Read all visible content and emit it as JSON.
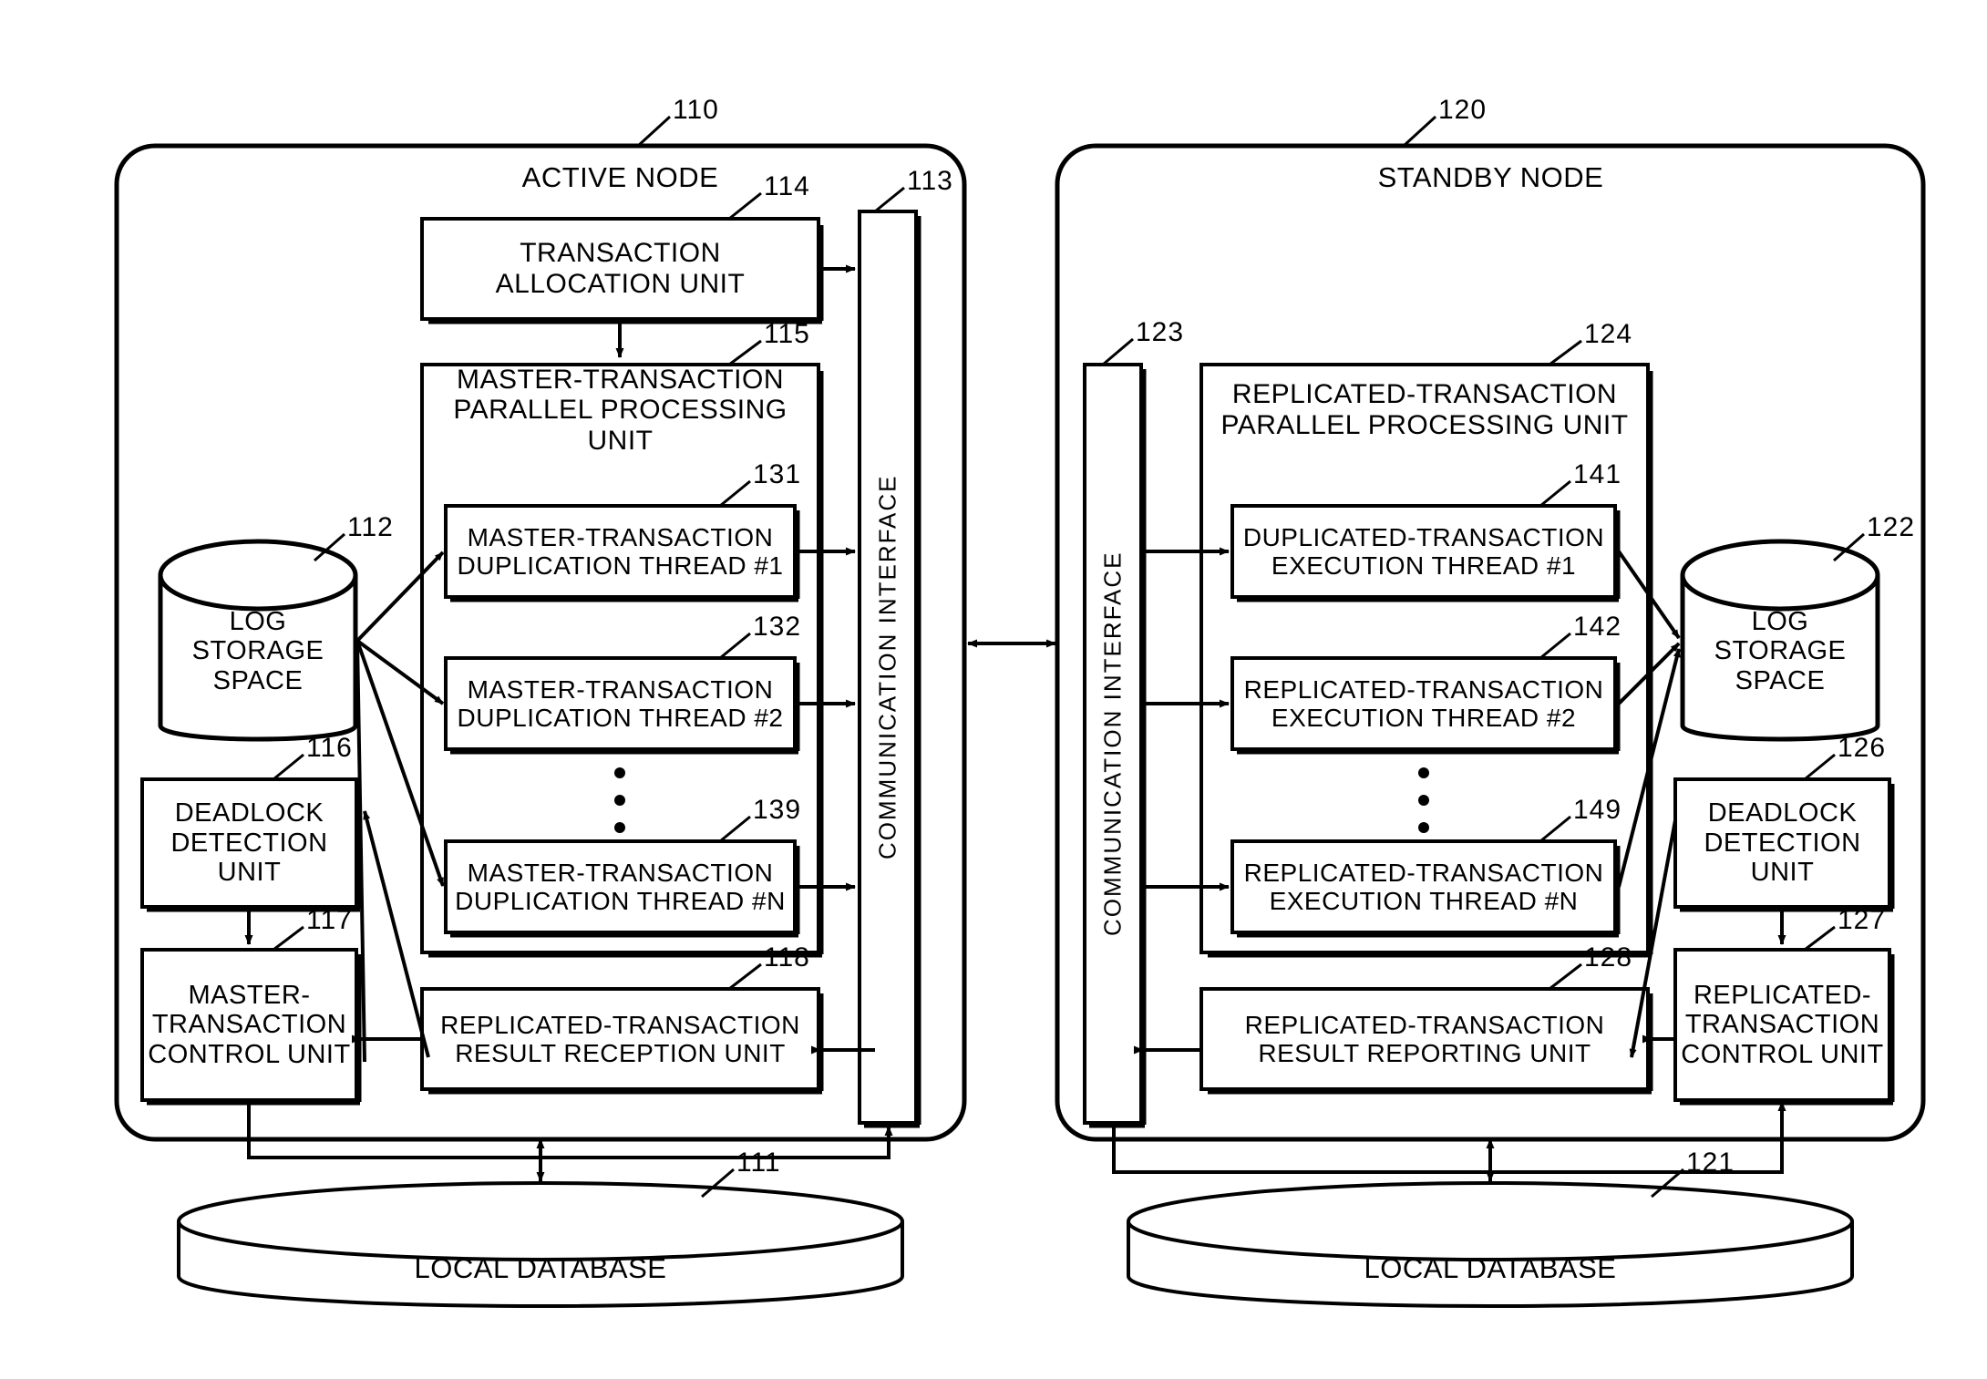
{
  "figure": {
    "type": "patent-block-diagram",
    "nodes": {
      "active": {
        "ref": "110",
        "title": "ACTIVE NODE",
        "local_database": {
          "ref": "111",
          "label": "LOCAL DATABASE"
        },
        "log_storage": {
          "ref": "112",
          "label": "LOG\nSTORAGE\nSPACE"
        },
        "communication_interface": {
          "ref": "113",
          "label": "COMMUNICATION INTERFACE"
        },
        "transaction_allocation_unit": {
          "ref": "114",
          "label": "TRANSACTION\nALLOCATION UNIT"
        },
        "parallel_processing_unit": {
          "ref": "115",
          "label": "MASTER-TRANSACTION\nPARALLEL PROCESSING UNIT"
        },
        "threads": [
          {
            "ref": "131",
            "label": "MASTER-TRANSACTION\nDUPLICATION THREAD #1"
          },
          {
            "ref": "132",
            "label": "MASTER-TRANSACTION\nDUPLICATION THREAD #2"
          },
          {
            "ref": "139",
            "label": "MASTER-TRANSACTION\nDUPLICATION THREAD #N"
          }
        ],
        "ellipsis": "•••",
        "deadlock_detection_unit": {
          "ref": "116",
          "label": "DEADLOCK\nDETECTION\nUNIT"
        },
        "control_unit": {
          "ref": "117",
          "label": "MASTER-\nTRANSACTION\nCONTROL UNIT"
        },
        "result_unit": {
          "ref": "118",
          "label": "REPLICATED-TRANSACTION\nRESULT RECEPTION UNIT"
        }
      },
      "standby": {
        "ref": "120",
        "title": "STANDBY NODE",
        "local_database": {
          "ref": "121",
          "label": "LOCAL DATABASE"
        },
        "log_storage": {
          "ref": "122",
          "label": "LOG\nSTORAGE\nSPACE"
        },
        "communication_interface": {
          "ref": "123",
          "label": "COMMUNICATION INTERFACE"
        },
        "parallel_processing_unit": {
          "ref": "124",
          "label": "REPLICATED-TRANSACTION\nPARALLEL PROCESSING UNIT"
        },
        "threads": [
          {
            "ref": "141",
            "label": "DUPLICATED-TRANSACTION\nEXECUTION THREAD #1"
          },
          {
            "ref": "142",
            "label": "REPLICATED-TRANSACTION\nEXECUTION THREAD #2"
          },
          {
            "ref": "149",
            "label": "REPLICATED-TRANSACTION\nEXECUTION THREAD #N"
          }
        ],
        "ellipsis": "•••",
        "deadlock_detection_unit": {
          "ref": "126",
          "label": "DEADLOCK\nDETECTION\nUNIT"
        },
        "control_unit": {
          "ref": "127",
          "label": "REPLICATED-\nTRANSACTION\nCONTROL UNIT"
        },
        "result_unit": {
          "ref": "128",
          "label": "REPLICATED-TRANSACTION\nRESULT REPORTING UNIT"
        }
      }
    },
    "colors": {
      "line": "#000000",
      "background": "#ffffff"
    }
  }
}
